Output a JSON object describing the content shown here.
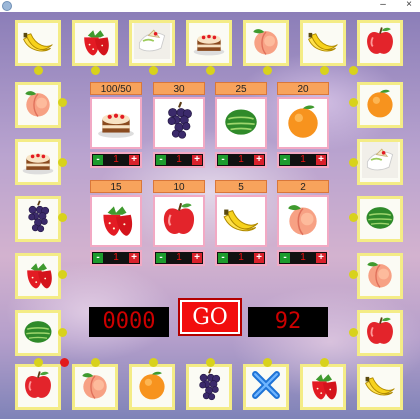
{
  "window": {
    "close_glyph": "×",
    "minimize_glyph": "–"
  },
  "ring_tiles": [
    "banana",
    "strawberry",
    "cake-plate",
    "cake",
    "peach",
    "banana",
    "apple",
    "orange",
    "cake-plate",
    "watermelon",
    "peach",
    "apple",
    "banana",
    "strawberry",
    "close-x",
    "grape",
    "orange",
    "peach",
    "apple",
    "watermelon",
    "strawberry",
    "grape",
    "cake",
    "peach"
  ],
  "bet_cards": [
    {
      "fruit": "cake",
      "odds": "100/50",
      "bet": "1"
    },
    {
      "fruit": "grape",
      "odds": "30",
      "bet": "1"
    },
    {
      "fruit": "watermelon",
      "odds": "25",
      "bet": "1"
    },
    {
      "fruit": "orange",
      "odds": "20",
      "bet": "1"
    },
    {
      "fruit": "strawberry",
      "odds": "15",
      "bet": "1"
    },
    {
      "fruit": "apple",
      "odds": "10",
      "bet": "1"
    },
    {
      "fruit": "banana",
      "odds": "5",
      "bet": "1"
    },
    {
      "fruit": "peach",
      "odds": "2",
      "bet": "1"
    }
  ],
  "controls": {
    "minus_label": "-",
    "plus_label": "+",
    "score": "0000",
    "go_label": "GO",
    "credits": "92"
  },
  "colors": {
    "dot": "#d8d21c",
    "active_dot": "#e31b1b",
    "tile_border": "#f4ec86"
  }
}
